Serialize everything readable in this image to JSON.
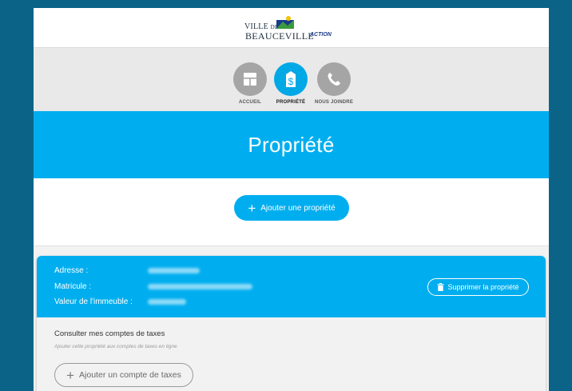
{
  "header": {
    "logo_ville": "VILLE",
    "logo_de": "DE",
    "logo_name": "BEAUCEVILLE",
    "logo_tag": "ACTION"
  },
  "nav": {
    "items": [
      {
        "label": "ACCUEIL",
        "icon": "home-icon",
        "active": false
      },
      {
        "label": "PROPRIÉTÉ",
        "icon": "dollar-tag-icon",
        "active": true
      },
      {
        "label": "NOUS JOINDRE",
        "icon": "phone-icon",
        "active": false
      }
    ]
  },
  "banner": {
    "title": "Propriété"
  },
  "main": {
    "add_property_label": "Ajouter une propriété"
  },
  "property_card": {
    "address_label": "Adresse :",
    "matricule_label": "Matricule :",
    "value_label": "Valeur de l'immeuble :",
    "delete_label": "Supprimer la propriété",
    "tax_title": "Consulter mes comptes de taxes",
    "tax_hint": "Ajouter cette propriété aux comptes de taxes en ligne",
    "add_tax_label": "Ajouter un compte de taxes"
  },
  "colors": {
    "background": "#0b6487",
    "accent": "#00aeef",
    "nav_background": "#e9e9e9",
    "inactive_circle": "#a5a5a5"
  }
}
